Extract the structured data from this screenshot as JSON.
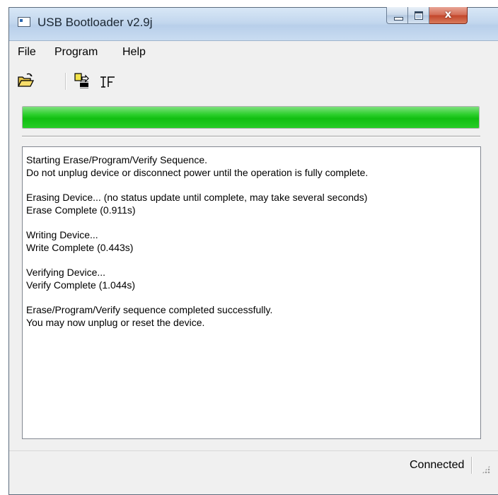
{
  "window": {
    "title": "USB Bootloader v2.9j"
  },
  "menu": [
    "File",
    "Program",
    "Help"
  ],
  "toolbar": {
    "buttons": [
      {
        "name": "open-file-icon"
      },
      {
        "name": "write-device-icon"
      },
      {
        "name": "reset-device-icon"
      }
    ]
  },
  "progress": {
    "percent": 100,
    "color": "#12bf12"
  },
  "log": {
    "lines": [
      "Starting Erase/Program/Verify Sequence.",
      "Do not unplug device or disconnect power until the operation is fully complete.",
      "",
      "Erasing Device... (no status update until complete, may take several seconds)",
      "Erase Complete (0.911s)",
      "",
      "Writing Device...",
      "Write Complete (0.443s)",
      "",
      "Verifying Device...",
      "Verify Complete (1.044s)",
      "",
      "Erase/Program/Verify sequence completed successfully.",
      "You may now unplug or reset the device."
    ]
  },
  "status": {
    "text": "Connected"
  }
}
